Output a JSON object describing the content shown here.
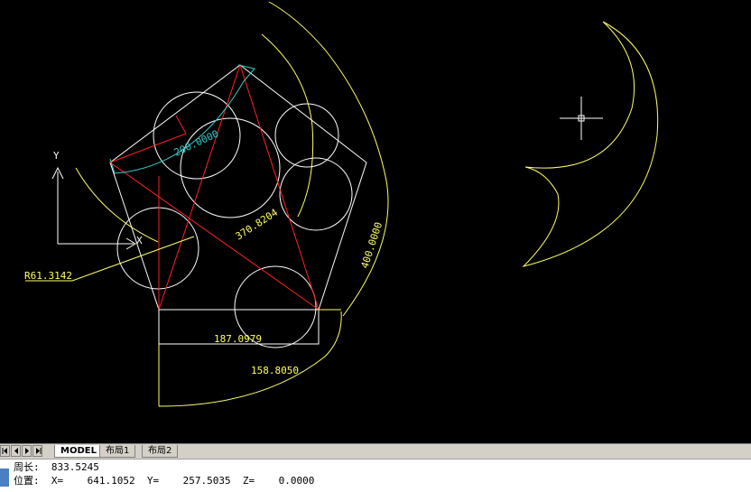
{
  "drawing": {
    "dimensions": {
      "aligned_200": "200.0000",
      "diagonal_370": "370.8204",
      "arc_radius_400": "400.0000",
      "radius_label": "R61.3142",
      "linear_187": "187.0979",
      "arc_158": "158.8050"
    },
    "ucs": {
      "y_label": "Y",
      "x_label": "X"
    },
    "colors": {
      "primary": "#ffff66",
      "accent_cyan": "#33cccc",
      "accent_red": "#ff2020",
      "white": "#ffffff",
      "crosshair": "#ffffff"
    }
  },
  "tabs": {
    "items": [
      {
        "label": "MODEL"
      },
      {
        "label": "布局1"
      },
      {
        "label": "布局2"
      }
    ]
  },
  "command": {
    "line1_label": "周长:",
    "line1_value": "833.5245",
    "line2_label": "位置:",
    "x_label": "X=",
    "x_value": "641.1052",
    "y_label": "Y=",
    "y_value": "257.5035",
    "z_label": "Z=",
    "z_value": "0.0000"
  }
}
